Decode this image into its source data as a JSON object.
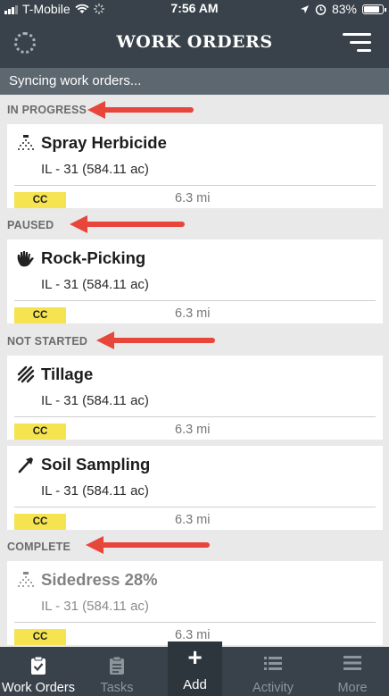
{
  "status_bar": {
    "carrier": "T-Mobile",
    "time": "7:56 AM",
    "battery": "83%",
    "battery_level": 0.83
  },
  "header": {
    "title": "WORK ORDERS",
    "left_icon": "loading-spinner-icon",
    "right_icon": "filter-menu-icon"
  },
  "sync_banner": "Syncing work orders...",
  "sections": [
    {
      "label": "IN PROGRESS"
    },
    {
      "label": "PAUSED"
    },
    {
      "label": "NOT STARTED"
    },
    {
      "label": "COMPLETE"
    }
  ],
  "orders": [
    {
      "name": "Spray Herbicide",
      "field": "IL - 31 (584.11 ac)",
      "badge": "CC",
      "distance": "6.3 mi",
      "icon": "spray-icon"
    },
    {
      "name": "Rock-Picking",
      "field": "IL - 31 (584.11 ac)",
      "badge": "CC",
      "distance": "6.3 mi",
      "icon": "glove-icon"
    },
    {
      "name": "Tillage",
      "field": "IL - 31 (584.11 ac)",
      "badge": "CC",
      "distance": "6.3 mi",
      "icon": "tillage-icon"
    },
    {
      "name": "Soil Sampling",
      "field": "IL - 31 (584.11 ac)",
      "badge": "CC",
      "distance": "6.3 mi",
      "icon": "soil-probe-icon"
    },
    {
      "name": "Sidedress 28%",
      "field": "IL - 31 (584.11 ac)",
      "badge": "CC",
      "distance": "6.3 mi",
      "icon": "spray-icon"
    }
  ],
  "tabs": [
    {
      "label": "Work Orders",
      "icon": "clipboard-check-icon",
      "active": true
    },
    {
      "label": "Tasks",
      "icon": "clipboard-icon"
    },
    {
      "label": "Add",
      "icon": "plus-icon"
    },
    {
      "label": "Activity",
      "icon": "list-icon"
    },
    {
      "label": "More",
      "icon": "hamburger-icon"
    }
  ],
  "colors": {
    "header_bg": "#39424a",
    "sync_banner_bg": "#5d676f",
    "badge_bg": "#f5e34f",
    "annotation_arrow": "#e8463a"
  }
}
